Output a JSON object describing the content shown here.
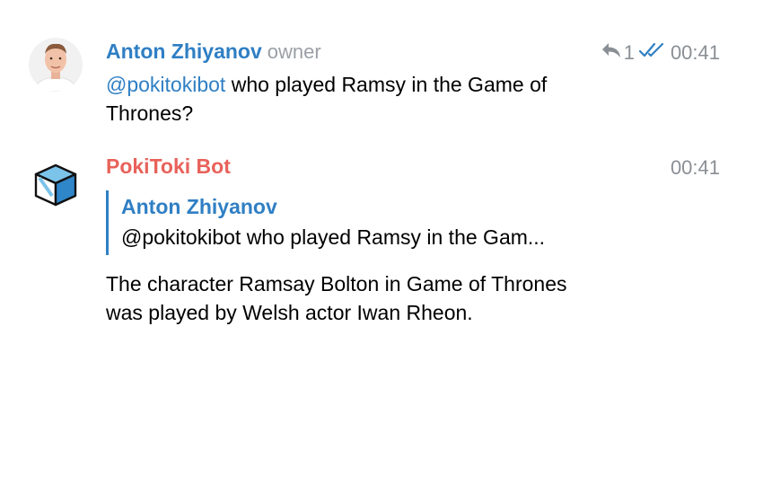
{
  "messages": [
    {
      "author": "Anton Zhiyanov",
      "author_color": "#2f7fc4",
      "role": "owner",
      "replies": "1",
      "time": "00:41",
      "mention": "@pokitokibot",
      "text": " who played Ramsy in the Game of Thrones?"
    },
    {
      "author": "PokiToki Bot",
      "author_color": "#e8625a",
      "time": "00:41",
      "quote": {
        "author": "Anton Zhiyanov",
        "text": "@pokitokibot who played Ramsy in the Gam..."
      },
      "text": "The character Ramsay Bolton in Game of Thrones was played by Welsh actor Iwan Rheon."
    }
  ],
  "colors": {
    "mention": "#2f7fc4",
    "meta": "#8a8f95",
    "check": "#2f7fc4"
  }
}
